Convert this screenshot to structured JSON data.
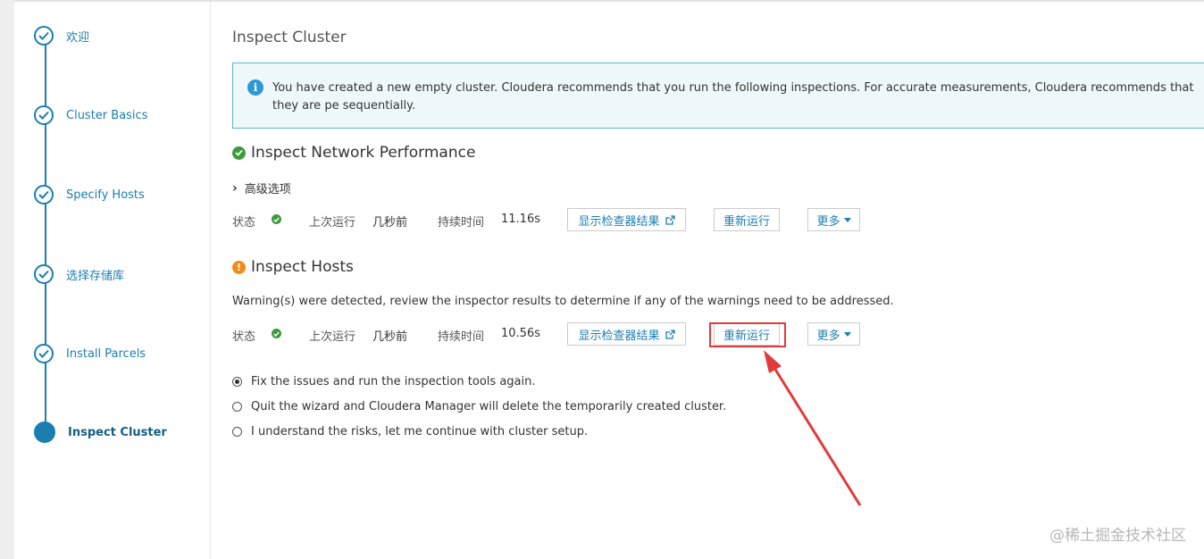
{
  "sidebar": {
    "steps": [
      {
        "label": "欢迎",
        "state": "done"
      },
      {
        "label": "Cluster Basics",
        "state": "done"
      },
      {
        "label": "Specify Hosts",
        "state": "done"
      },
      {
        "label": "选择存储库",
        "state": "done"
      },
      {
        "label": "Install Parcels",
        "state": "done"
      },
      {
        "label": "Inspect Cluster",
        "state": "active"
      }
    ]
  },
  "main": {
    "title": "Inspect Cluster",
    "alert": "You have created a new empty cluster. Cloudera recommends that you run the following inspections. For accurate measurements, Cloudera recommends that they are pe sequentially.",
    "network": {
      "title": "Inspect Network Performance",
      "advanced": "高级选项",
      "status_label": "状态",
      "last_run_label": "上次运行",
      "last_run": "几秒前",
      "duration_label": "持续时间",
      "duration": "11.16s",
      "show_results": "显示检查器结果",
      "rerun": "重新运行",
      "more": "更多"
    },
    "hosts": {
      "title": "Inspect Hosts",
      "warning": "Warning(s) were detected, review the inspector results to determine if any of the warnings need to be addressed.",
      "status_label": "状态",
      "last_run_label": "上次运行",
      "last_run": "几秒前",
      "duration_label": "持续时间",
      "duration": "10.56s",
      "show_results": "显示检查器结果",
      "rerun": "重新运行",
      "more": "更多"
    },
    "options": [
      {
        "label": "Fix the issues and run the inspection tools again.",
        "selected": true
      },
      {
        "label": "Quit the wizard and Cloudera Manager will delete the temporarily created cluster.",
        "selected": false
      },
      {
        "label": "I understand the risks, let me continue with cluster setup.",
        "selected": false
      }
    ]
  },
  "watermark": "@稀土掘金技术社区",
  "colors": {
    "accent": "#1b7eb0",
    "ok": "#3c9a3c",
    "warn": "#ef8b1c",
    "annotation": "#e23a3a"
  }
}
